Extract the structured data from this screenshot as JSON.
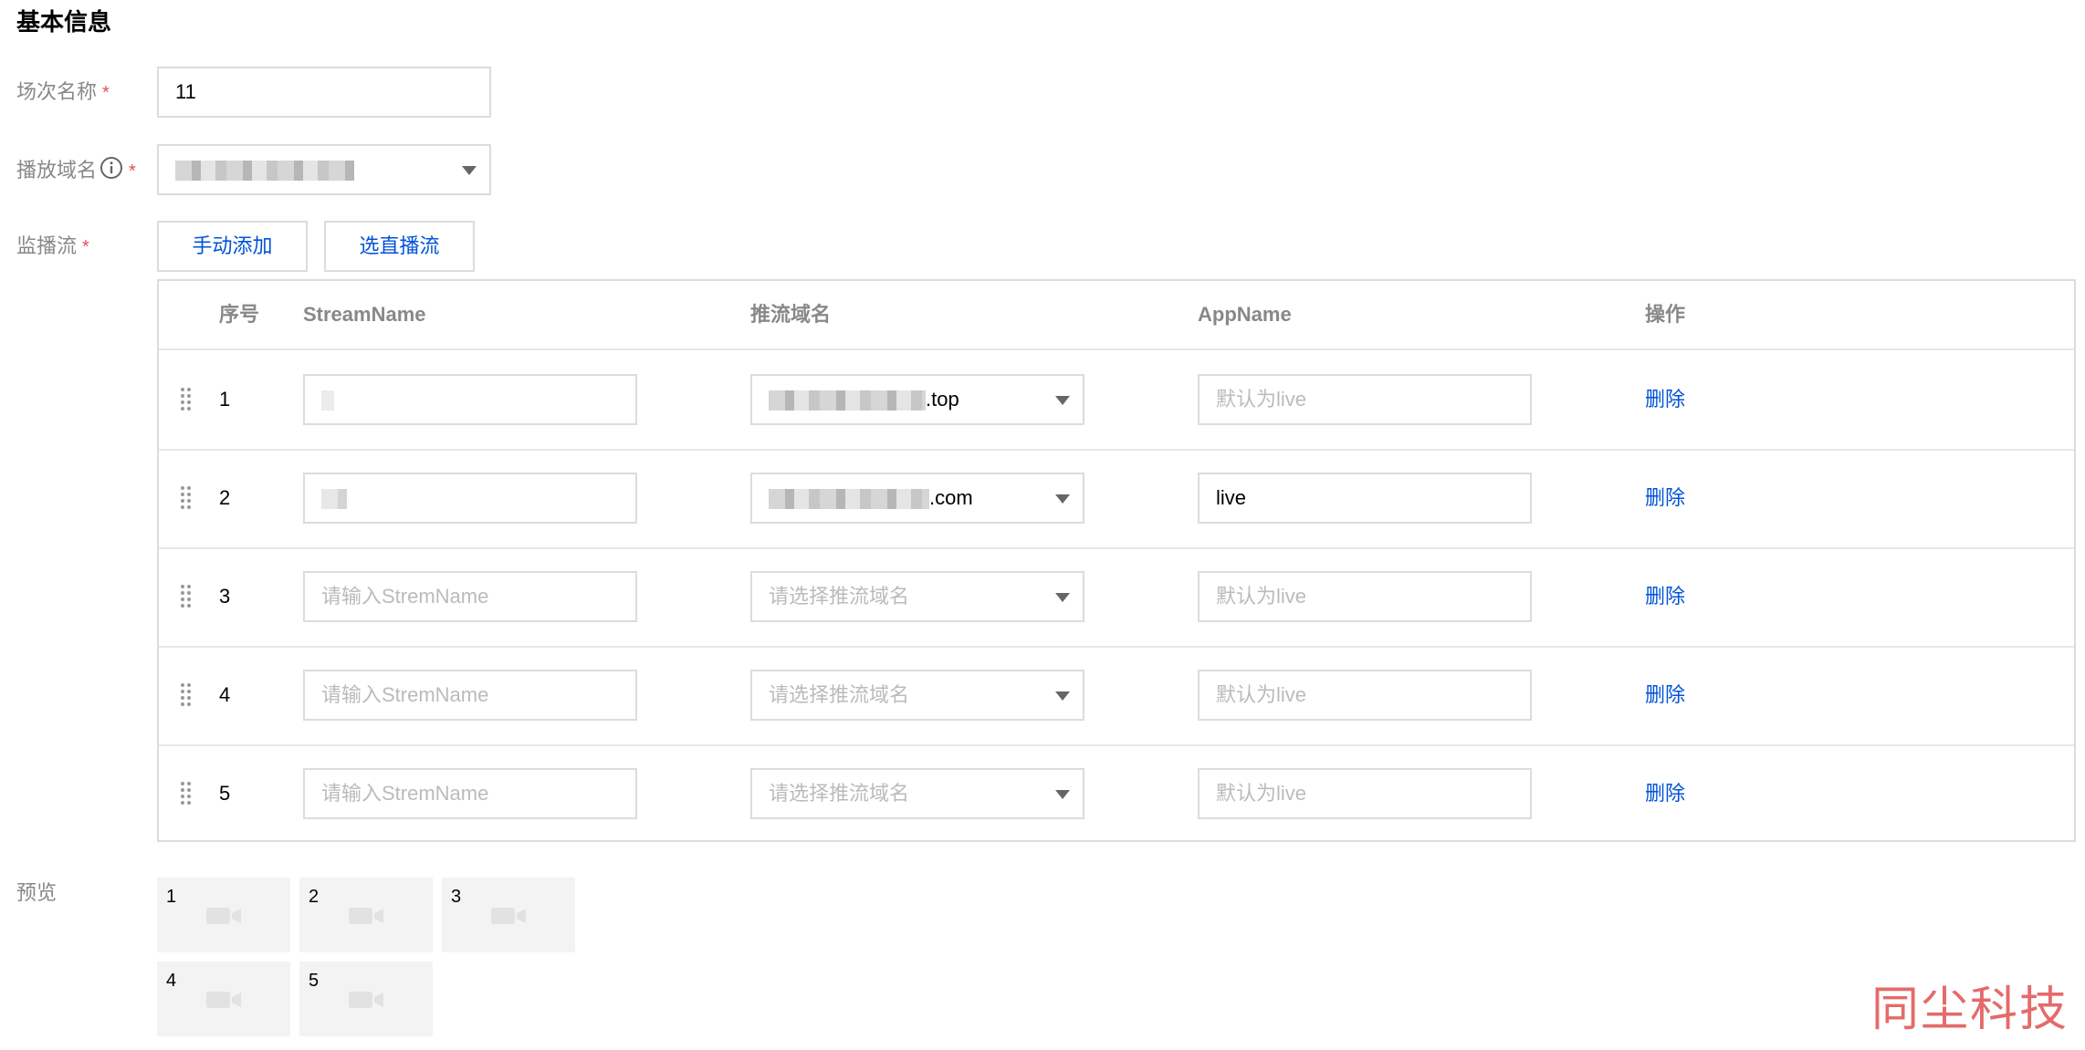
{
  "section_title": "基本信息",
  "fields": {
    "session_name_label": "场次名称",
    "session_name_value": "11",
    "play_domain_label": "播放域名",
    "monitor_stream_label": "监播流",
    "required_mark": "*"
  },
  "buttons": {
    "manual_add": "手动添加",
    "select_live": "选直播流"
  },
  "table": {
    "headers": [
      "序号",
      "StreamName",
      "推流域名",
      "AppName",
      "操作"
    ],
    "rows": [
      {
        "index": "1",
        "stream_name": "",
        "push_domain_suffix": ".top",
        "app_name": "",
        "action": "删除"
      },
      {
        "index": "2",
        "stream_name": "",
        "push_domain_suffix": ".com",
        "app_name": "live",
        "action": "删除"
      },
      {
        "index": "3",
        "stream_name": "",
        "push_domain_suffix": "",
        "app_name": "",
        "action": "删除"
      },
      {
        "index": "4",
        "stream_name": "",
        "push_domain_suffix": "",
        "app_name": "",
        "action": "删除"
      },
      {
        "index": "5",
        "stream_name": "",
        "push_domain_suffix": "",
        "app_name": "",
        "action": "删除"
      }
    ],
    "stream_name_placeholder": "请输入StremName",
    "push_domain_placeholder": "请选择推流域名",
    "app_name_placeholder": "默认为live"
  },
  "preview": {
    "label": "预览",
    "tiles": [
      "1",
      "2",
      "3",
      "4",
      "5"
    ]
  },
  "watermark": "同尘科技",
  "colors": {
    "link_blue": "#0052d9",
    "required_red": "#e34d59",
    "border": "#dcdcdc",
    "watermark": "#e56a6a"
  },
  "icons": {
    "info": "info-icon",
    "dropdown": "chevron-down-icon",
    "drag": "drag-handle-icon",
    "camera": "video-camera-icon"
  }
}
